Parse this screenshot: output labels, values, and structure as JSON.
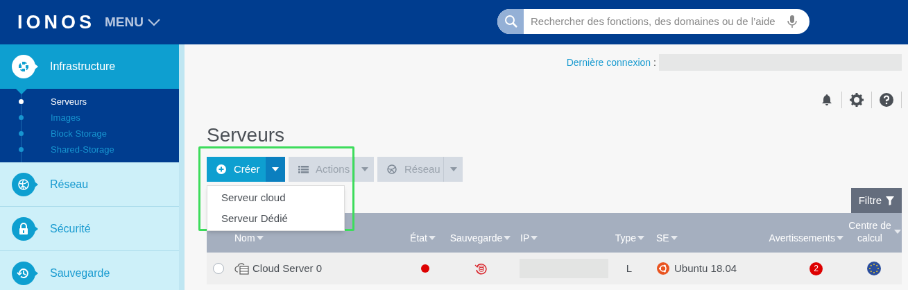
{
  "header": {
    "logo": "IONOS",
    "menu": "MENU",
    "search": {
      "placeholder": "Rechercher des fonctions, des domaines ou de l’aide"
    }
  },
  "sidebar": {
    "items": [
      {
        "label": "Infrastructure",
        "selected": true,
        "children": [
          {
            "label": "Serveurs",
            "selected": true
          },
          {
            "label": "Images",
            "selected": false
          },
          {
            "label": "Block Storage",
            "selected": false
          },
          {
            "label": "Shared-Storage",
            "selected": false
          }
        ]
      },
      {
        "label": "Réseau",
        "selected": false
      },
      {
        "label": "Sécurité",
        "selected": false
      },
      {
        "label": "Sauvegarde",
        "selected": false
      }
    ]
  },
  "last_login": {
    "label": "Dernière connexion",
    "separator": ":"
  },
  "page_title": "Serveurs",
  "toolbar": [
    {
      "label": "Créer",
      "disabled": false,
      "expanded": true
    },
    {
      "label": "Actions",
      "disabled": true,
      "expanded": false
    },
    {
      "label": "Réseau",
      "disabled": true,
      "expanded": false
    }
  ],
  "dropdown": [
    "Serveur cloud",
    "Serveur Dédié"
  ],
  "filter_button": "Filtre",
  "table": {
    "columns": [
      "Nom",
      "État",
      "Sauvegarde",
      "IP",
      "Type",
      "SE",
      "Avertissements",
      "Centre de calcul"
    ],
    "rows": [
      {
        "selected": false,
        "name": "Cloud Server 0",
        "color": "#dd0000",
        "type": "L",
        "os": "Ubuntu 18.04",
        "warnings": "2"
      }
    ]
  }
}
